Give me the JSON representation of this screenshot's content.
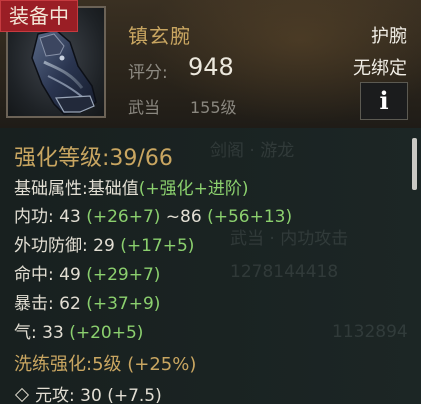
{
  "header": {
    "equipped_badge": "装备中",
    "item_name": "镇玄腕",
    "score_label": "评分:",
    "score_value": "948",
    "sect": "武当",
    "level": "155级",
    "slot": "护腕",
    "bind_status": "无绑定",
    "info_icon": "i"
  },
  "refine": {
    "title": "强化等级:",
    "value": "39/66"
  },
  "attributes": {
    "header": "基础属性:",
    "header_value_prefix": "基础值",
    "header_value_green": "(+强化+进阶)",
    "rows": [
      {
        "label": "内功:",
        "base": "43",
        "bonus": "(+26+7)",
        "tilde": "~86",
        "bonus2": "(+56+13)"
      },
      {
        "label": "外功防御:",
        "base": "29",
        "bonus": "(+17+5)"
      },
      {
        "label": "命中:",
        "base": "49",
        "bonus": "(+29+7)"
      },
      {
        "label": "暴击:",
        "base": "62",
        "bonus": "(+37+9)"
      },
      {
        "label": "气:",
        "base": "33",
        "bonus": "(+20+5)"
      }
    ]
  },
  "wash": {
    "title": "洗练强化:",
    "value": "5级 (+25%)"
  },
  "sub_attr": {
    "label": "元攻:",
    "base": "30",
    "bonus": "(+7.5)"
  },
  "background_text": {
    "line1": "剑阁 · 游龙",
    "line2": "武当 · 内功攻击",
    "line3": "1278144418",
    "line4": "1132894"
  },
  "icons": {
    "item_icon": "bracer-icon",
    "diamond_icon": "diamond-icon"
  },
  "colors": {
    "gold": "#c9a661",
    "green": "#8bd06e",
    "badge_red": "#9a1e25"
  }
}
